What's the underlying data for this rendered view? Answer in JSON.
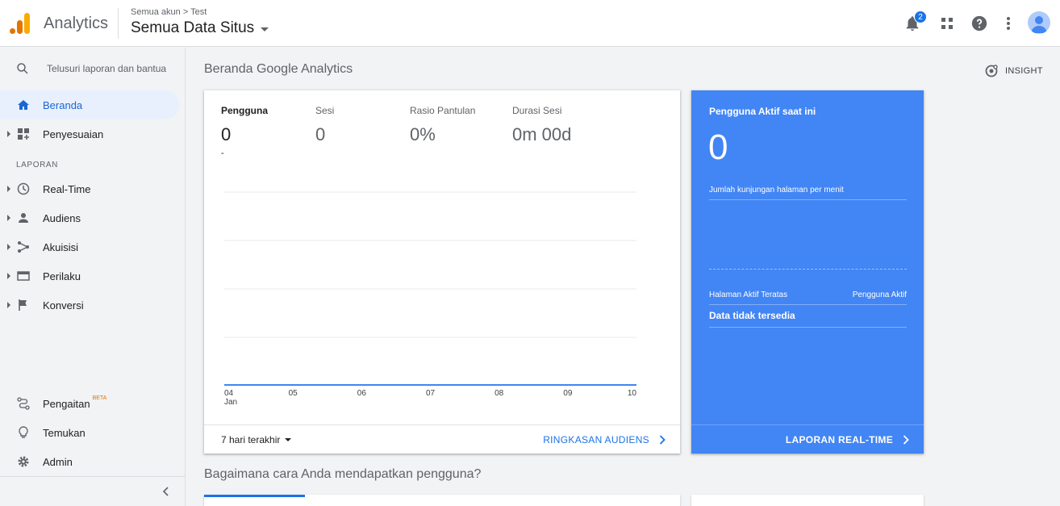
{
  "header": {
    "app_name": "Analytics",
    "breadcrumb": "Semua akun > Test",
    "account_title": "Semua Data Situs",
    "notification_count": "2",
    "brand_colors": [
      "#f9ab00",
      "#e37400"
    ]
  },
  "sidebar": {
    "search_placeholder": "Telusuri laporan dan bantua",
    "top_items": [
      {
        "label": "Beranda",
        "icon": "home-icon",
        "active": true
      },
      {
        "label": "Penyesuaian",
        "icon": "dashboard-icon"
      }
    ],
    "section_label": "LAPORAN",
    "report_items": [
      {
        "label": "Real-Time",
        "icon": "clock-icon"
      },
      {
        "label": "Audiens",
        "icon": "person-icon"
      },
      {
        "label": "Akuisisi",
        "icon": "acquisition-icon"
      },
      {
        "label": "Perilaku",
        "icon": "behavior-icon"
      },
      {
        "label": "Konversi",
        "icon": "flag-icon"
      }
    ],
    "bottom_items": [
      {
        "label": "Pengaitan",
        "icon": "attribution-icon",
        "badge": "BETA"
      },
      {
        "label": "Temukan",
        "icon": "lightbulb-icon"
      },
      {
        "label": "Admin",
        "icon": "gear-icon"
      }
    ]
  },
  "main": {
    "page_title": "Beranda Google Analytics",
    "insight_label": "INSIGHT",
    "metrics": [
      {
        "label": "Pengguna",
        "value": "0"
      },
      {
        "label": "Sesi",
        "value": "0"
      },
      {
        "label": "Rasio Pantulan",
        "value": "0%"
      },
      {
        "label": "Durasi Sesi",
        "value": "0m 00d"
      }
    ],
    "metric_change": "-",
    "period_label": "7 hari terakhir",
    "audience_link": "RINGKASAN AUDIENS",
    "section2_title": "Bagaimana cara Anda mendapatkan pengguna?"
  },
  "chart_data": {
    "type": "line",
    "categories": [
      "04 Jan",
      "05",
      "06",
      "07",
      "08",
      "09",
      "10"
    ],
    "series": [
      {
        "name": "Pengguna",
        "values": [
          0,
          0,
          0,
          0,
          0,
          0,
          0
        ]
      }
    ],
    "x_tick_labels": [
      "04",
      "05",
      "06",
      "07",
      "08",
      "09",
      "10"
    ],
    "x_tick_sublabel": "Jan",
    "grid": true,
    "line_color": "#4285f4"
  },
  "realtime": {
    "title": "Pengguna Aktif saat ini",
    "value": "0",
    "subtitle": "Jumlah kunjungan halaman per menit",
    "col1": "Halaman Aktif Teratas",
    "col2": "Pengguna Aktif",
    "no_data": "Data tidak tersedia",
    "link": "LAPORAN REAL-TIME",
    "bg_color": "#4285f4"
  }
}
